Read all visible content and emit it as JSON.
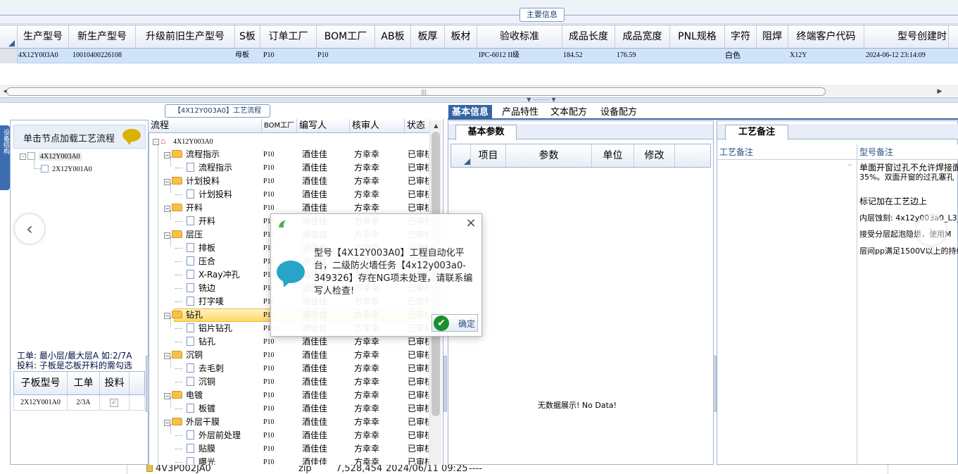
{
  "main_info": {
    "title": "主要信息"
  },
  "grid": {
    "columns": [
      "生产型号",
      "新生产型号",
      "升级前旧生产型号",
      "S板",
      "订单工厂",
      "BOM工厂",
      "AB板",
      "板厚",
      "板材",
      "验收标准",
      "成品长度",
      "成品宽度",
      "PNL规格",
      "字符",
      "阻焊",
      "终端客户代码",
      "型号创建时"
    ],
    "row": {
      "prod_model": "4X12Y003A0",
      "new_model": "10010400226108",
      "old_model": "",
      "s_board": "母板",
      "order_factory": "P10",
      "bom_factory": "P10",
      "ab_board": "",
      "thickness": "",
      "material": "",
      "standard": "IPC-6012 II级",
      "length": "184.52",
      "width": "176.59",
      "pnl": "",
      "char": "白色",
      "solder": "",
      "customer": "X12Y",
      "created": "2024-06-12 23:14:09"
    }
  },
  "left_panel": {
    "vertical_tab": "设备结构",
    "load_hint": "单击节点加载工艺流程",
    "tree": [
      {
        "label": "4X12Y003A0",
        "level": 0
      },
      {
        "label": "2X12Y001A0",
        "level": 1
      }
    ],
    "note1": "工单: 最小层/最大层A 如:2/7A",
    "note2": "投料: 子板是芯板开料的需勾选",
    "sub_grid": {
      "columns": [
        "子板型号",
        "工单",
        "投料"
      ],
      "row": {
        "model": "2X12Y001A0",
        "order": "2/3A",
        "feed": "✓"
      }
    }
  },
  "flow": {
    "title": "【4X12Y003A0】工艺流程",
    "columns": [
      "流程",
      "BOM工厂",
      "编写人",
      "核审人",
      "状态"
    ],
    "root": "4X12Y003A0",
    "rows": [
      {
        "name": "流程指示",
        "type": "folder",
        "bom": "P10",
        "writer": "酒佳佳",
        "reviewer": "方幸幸",
        "status": "已审核"
      },
      {
        "name": "流程指示",
        "type": "doc",
        "bom": "P10",
        "writer": "酒佳佳",
        "reviewer": "方幸幸",
        "status": "已审核"
      },
      {
        "name": "计划投料",
        "type": "folder",
        "bom": "P10",
        "writer": "酒佳佳",
        "reviewer": "方幸幸",
        "status": "已审核"
      },
      {
        "name": "计划投料",
        "type": "doc",
        "bom": "P10",
        "writer": "酒佳佳",
        "reviewer": "方幸幸",
        "status": "已审核"
      },
      {
        "name": "开料",
        "type": "folder",
        "bom": "P10",
        "writer": "酒佳佳",
        "reviewer": "方幸幸",
        "status": "已审核"
      },
      {
        "name": "开料",
        "type": "doc",
        "bom": "P10",
        "writer": "酒佳佳",
        "reviewer": "方幸幸",
        "status": "已审核"
      },
      {
        "name": "层压",
        "type": "folder",
        "bom": "P10",
        "writer": "酒佳佳",
        "reviewer": "方幸幸",
        "status": "已审核"
      },
      {
        "name": "排板",
        "type": "doc",
        "bom": "P10",
        "writer": "酒佳佳",
        "reviewer": "方幸幸",
        "status": "已审核"
      },
      {
        "name": "压合",
        "type": "doc",
        "bom": "P10",
        "writer": "酒佳佳",
        "reviewer": "方幸幸",
        "status": "已审核"
      },
      {
        "name": "X-Ray冲孔",
        "type": "doc",
        "bom": "P10",
        "writer": "酒佳佳",
        "reviewer": "方幸幸",
        "status": "已审核"
      },
      {
        "name": "铣边",
        "type": "doc",
        "bom": "P10",
        "writer": "酒佳佳",
        "reviewer": "方幸幸",
        "status": "已审核"
      },
      {
        "name": "打字唛",
        "type": "doc",
        "bom": "P10",
        "writer": "酒佳佳",
        "reviewer": "方幸幸",
        "status": "已审核"
      },
      {
        "name": "钻孔",
        "type": "folder",
        "bom": "P10",
        "writer": "酒佳佳",
        "reviewer": "方幸幸",
        "status": "已审核"
      },
      {
        "name": "铝片钻孔",
        "type": "doc",
        "bom": "P10",
        "writer": "酒佳佳",
        "reviewer": "方幸幸",
        "status": "已审核"
      },
      {
        "name": "钻孔",
        "type": "doc",
        "bom": "P10",
        "writer": "酒佳佳",
        "reviewer": "方幸幸",
        "status": "已审核"
      },
      {
        "name": "沉铜",
        "type": "folder",
        "bom": "P10",
        "writer": "酒佳佳",
        "reviewer": "方幸幸",
        "status": "已审核"
      },
      {
        "name": "去毛刺",
        "type": "doc",
        "bom": "P10",
        "writer": "酒佳佳",
        "reviewer": "方幸幸",
        "status": "已审核"
      },
      {
        "name": "沉铜",
        "type": "doc",
        "bom": "P10",
        "writer": "酒佳佳",
        "reviewer": "方幸幸",
        "status": "已审核"
      },
      {
        "name": "电镀",
        "type": "folder",
        "bom": "P10",
        "writer": "酒佳佳",
        "reviewer": "方幸幸",
        "status": "已审核"
      },
      {
        "name": "板镀",
        "type": "doc",
        "bom": "P10",
        "writer": "酒佳佳",
        "reviewer": "方幸幸",
        "status": "已审核"
      },
      {
        "name": "外层干膜",
        "type": "folder",
        "bom": "P10",
        "writer": "酒佳佳",
        "reviewer": "方幸幸",
        "status": "已审核"
      },
      {
        "name": "外层前处理",
        "type": "doc",
        "bom": "P10",
        "writer": "酒佳佳",
        "reviewer": "方幸幸",
        "status": "已审核"
      },
      {
        "name": "贴膜",
        "type": "doc",
        "bom": "P10",
        "writer": "酒佳佳",
        "reviewer": "方幸幸",
        "status": "已审核"
      },
      {
        "name": "曝光",
        "type": "doc",
        "bom": "P10",
        "writer": "酒佳佳",
        "reviewer": "方幸幸",
        "status": "已审核"
      }
    ]
  },
  "tabs": [
    "基本信息",
    "产品特性",
    "文本配方",
    "设备配方"
  ],
  "params": {
    "tab": "基本参数",
    "columns": [
      "项目",
      "参数",
      "单位",
      "修改"
    ],
    "empty": "无数据展示! No Data!"
  },
  "remarks": {
    "tab": "工艺备注",
    "col1": "工艺备注",
    "col2": "型号备注",
    "lines": [
      "单面开窗过孔不允许焊接面",
      "35%。双面开窗的过孔塞孔",
      "",
      "标记加在工艺边上",
      "内层蚀刻: 4x12y003a0_L3_",
      "接受分层起泡隐患，使用M",
      "层间pp满足1500V以上的持续"
    ]
  },
  "dialog": {
    "message": "型号【4X12Y003A0】工程自动化平台，二级防火墙任务【4x12y003a0-349326】存在NG项未处理，请联系编写人检查!",
    "ok_label": "确定",
    "close": "×"
  },
  "file_strip": {
    "name": "4V3P002JA0",
    "type": "zip",
    "size": "7,528,454",
    "date": "2024/06/11 09:25",
    "attr": "----"
  },
  "icons": {
    "prev": "‹",
    "next": "›",
    "check": "✔"
  }
}
